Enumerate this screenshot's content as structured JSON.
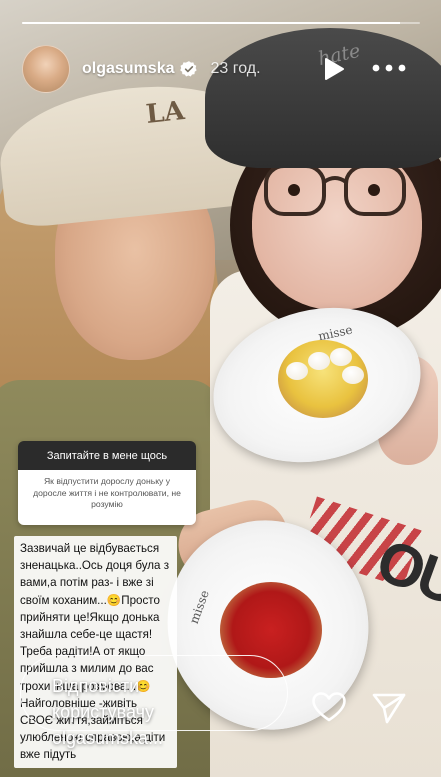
{
  "story": {
    "progress": 0.95
  },
  "header": {
    "username": "olgasumska",
    "time": "23 год.",
    "icons": {
      "avatar": "profile-avatar",
      "verified": "verified-badge-icon",
      "play": "play-icon",
      "more": "more-dots-icon"
    }
  },
  "photo": {
    "cap_logo": "LA",
    "cap_right_text": "hate",
    "plate_brand": "misse",
    "shirt_print": "OU"
  },
  "question_box": {
    "title": "Запитайте в мене щось",
    "question": "Як відпустити дорослу доньку у доросле життя і не контролювати, не розумію"
  },
  "reply": {
    "text": "Зазвичай це відбувається зненацька..Ось доця була з вами,а потім раз- і вже зі своїм коханим...😊Просто прийняти це!Якщо донька знайшла себе-це щастя! Треба радіти!А от якщо прийшла з милим до вас трохи інша розмова...😊 Найголовніше -живіть СВОЄ життя,займіться улюбленою справою,а діти вже підуть"
  },
  "footer": {
    "message_placeholder": "Відповісти користувачу olgasumska...",
    "icons": {
      "like": "heart-icon",
      "share": "send-icon"
    }
  }
}
